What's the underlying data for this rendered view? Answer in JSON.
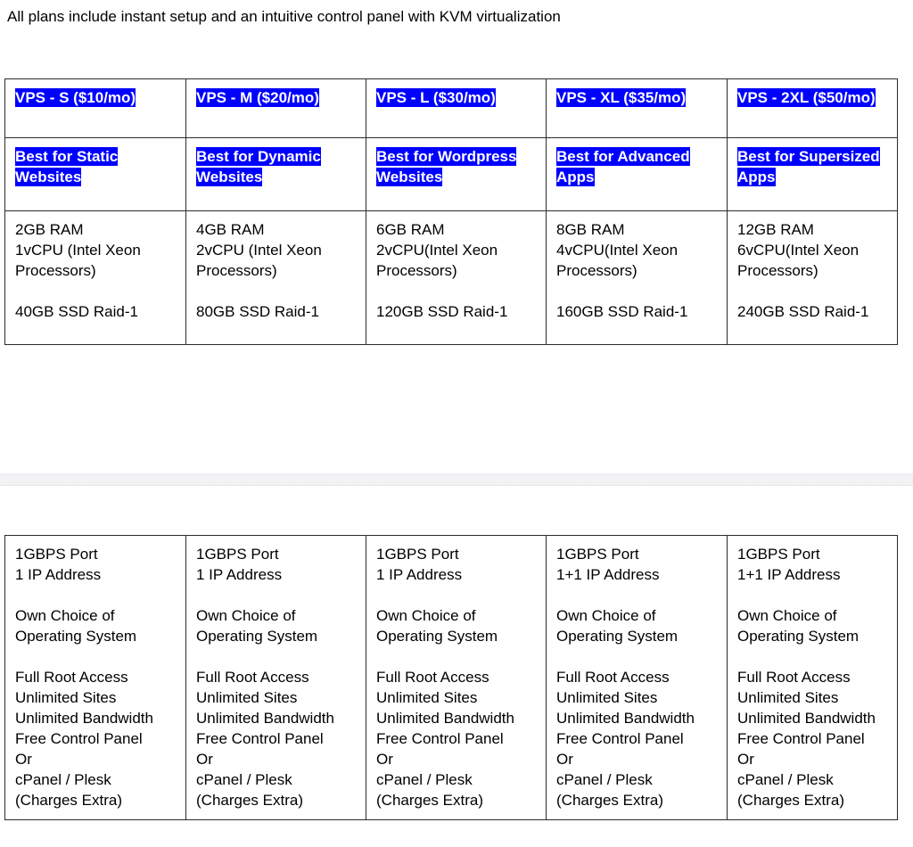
{
  "intro": {
    "text": "All plans include instant setup and an intuitive control panel with KVM virtualization"
  },
  "colors": {
    "selection_background": "#0000FF",
    "selection_text": "#FFFFFF",
    "table_border": "#2B2B2B",
    "page_background": "#FFFFFF",
    "page_break_band": "#F2F2F4"
  },
  "table_top": {
    "rows": {
      "titles": [
        "VPS - S  ($10/mo)",
        "VPS - M ($20/mo)",
        "VPS - L ($30/mo)",
        "VPS - XL ($35/mo)",
        "VPS - 2XL ($50/mo)"
      ],
      "best_for": [
        "Best for Static Websites",
        "Best for Dynamic Websites",
        "Best for Wordpress Websites",
        "Best for Advanced Apps",
        "Best for Supersized Apps"
      ],
      "specs": [
        "2GB RAM\n1vCPU (Intel Xeon Processors)",
        "4GB RAM\n2vCPU (Intel Xeon Processors)",
        "6GB RAM\n2vCPU(Intel Xeon Processors)",
        "8GB RAM\n4vCPU(Intel Xeon Processors)",
        "12GB RAM\n6vCPU(Intel Xeon Processors)"
      ],
      "storage": [
        "40GB SSD Raid-1",
        "80GB SSD Raid-1",
        "120GB SSD Raid-1",
        "160GB SSD Raid-1",
        "240GB SSD Raid-1"
      ]
    }
  },
  "table_bottom": {
    "rows": {
      "network": [
        "1GBPS Port\n1 IP Address",
        "1GBPS Port\n1 IP Address",
        "1GBPS Port\n1 IP Address",
        "1GBPS Port\n1+1 IP Address",
        "1GBPS Port\n1+1 IP Address"
      ],
      "os": [
        "Own Choice of Operating System",
        "Own Choice of Operating System",
        "Own Choice of Operating System",
        "Own Choice of Operating System",
        "Own Choice of Operating System"
      ],
      "features": [
        "Full Root Access\nUnlimited Sites\nUnlimited Bandwidth\nFree Control Panel\nOr\ncPanel / Plesk\n(Charges Extra)",
        "Full Root Access\nUnlimited Sites\nUnlimited Bandwidth\nFree Control Panel\nOr\ncPanel / Plesk\n(Charges Extra)",
        "Full Root Access\nUnlimited Sites\nUnlimited Bandwidth\nFree Control Panel\nOr\ncPanel / Plesk\n(Charges Extra)",
        "Full Root Access\nUnlimited Sites\nUnlimited Bandwidth\nFree Control Panel\nOr\ncPanel / Plesk\n(Charges Extra)",
        "Full Root Access\nUnlimited Sites\nUnlimited Bandwidth\nFree Control Panel\nOr\ncPanel / Plesk\n(Charges Extra)"
      ]
    }
  }
}
